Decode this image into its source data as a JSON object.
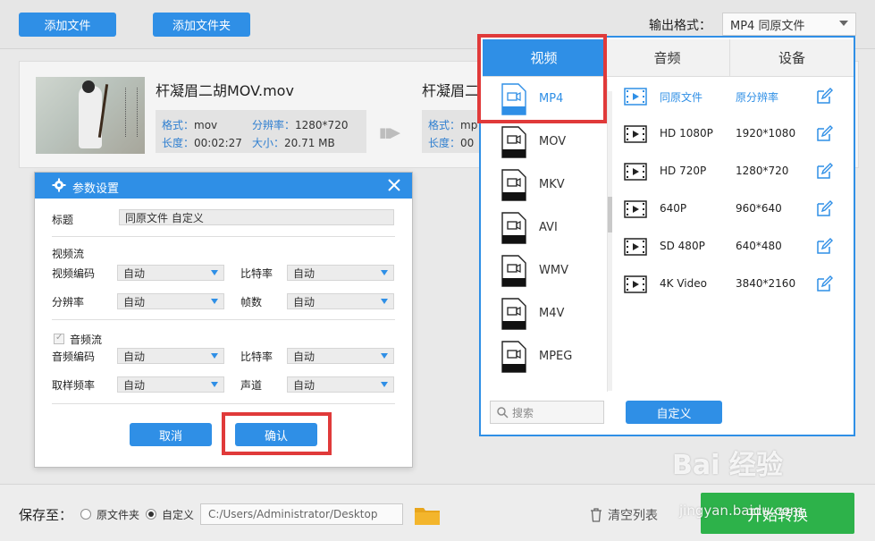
{
  "toolbar": {
    "add_file": "添加文件",
    "add_folder": "添加文件夹",
    "output_format_label": "输出格式：",
    "output_format_value": "MP4  同原文件"
  },
  "file": {
    "source_name": "杆凝眉二胡MOV.mov",
    "source_format_key": "格式：",
    "source_format": "mov",
    "source_resolution_key": "分辨率：",
    "source_resolution": "1280*720",
    "source_duration_key": "长度：",
    "source_duration": "00:02:27",
    "source_size_key": "大小：",
    "source_size": "20.71 MB",
    "target_name": "杆凝眉二",
    "target_format_key": "格式：",
    "target_format": "mp",
    "target_duration_key": "长度：",
    "target_duration": "00"
  },
  "dialog": {
    "title": "参数设置",
    "title_label": "标题",
    "title_value": "同原文件 自定义",
    "video_stream": "视频流",
    "video_codec_label": "视频编码",
    "video_codec": "自动",
    "video_bitrate_label": "比特率",
    "video_bitrate": "自动",
    "resolution_label": "分辨率",
    "resolution": "自动",
    "framerate_label": "帧数",
    "framerate": "自动",
    "audio_stream": "音频流",
    "audio_codec_label": "音频编码",
    "audio_codec": "自动",
    "audio_bitrate_label": "比特率",
    "audio_bitrate": "自动",
    "sample_rate_label": "取样频率",
    "sample_rate": "自动",
    "channel_label": "声道",
    "channel": "自动",
    "cancel": "取消",
    "confirm": "确认"
  },
  "format_panel": {
    "tabs": [
      "视频",
      "音频",
      "设备"
    ],
    "formats": [
      "MP4",
      "MOV",
      "MKV",
      "AVI",
      "WMV",
      "M4V",
      "MPEG"
    ],
    "presets": [
      {
        "name": "同原文件",
        "res": "原分辨率"
      },
      {
        "name": "HD 1080P",
        "res": "1920*1080"
      },
      {
        "name": "HD 720P",
        "res": "1280*720"
      },
      {
        "name": "640P",
        "res": "960*640"
      },
      {
        "name": "SD 480P",
        "res": "640*480"
      },
      {
        "name": "4K Video",
        "res": "3840*2160"
      }
    ],
    "search_placeholder": "搜索",
    "custom": "自定义"
  },
  "bottom": {
    "save_to": "保存至：",
    "opt_original": "原文件夹",
    "opt_custom": "自定义",
    "path": "C:/Users/Administrator/Desktop",
    "clear_list": "清空列表",
    "start": "开始转换"
  },
  "watermark": {
    "brand": "Bai 经验",
    "url": "jingyan.baidu.com"
  },
  "colors": {
    "accent": "#2f8fe6",
    "highlight": "#e03a3a",
    "start": "#2db24a"
  }
}
